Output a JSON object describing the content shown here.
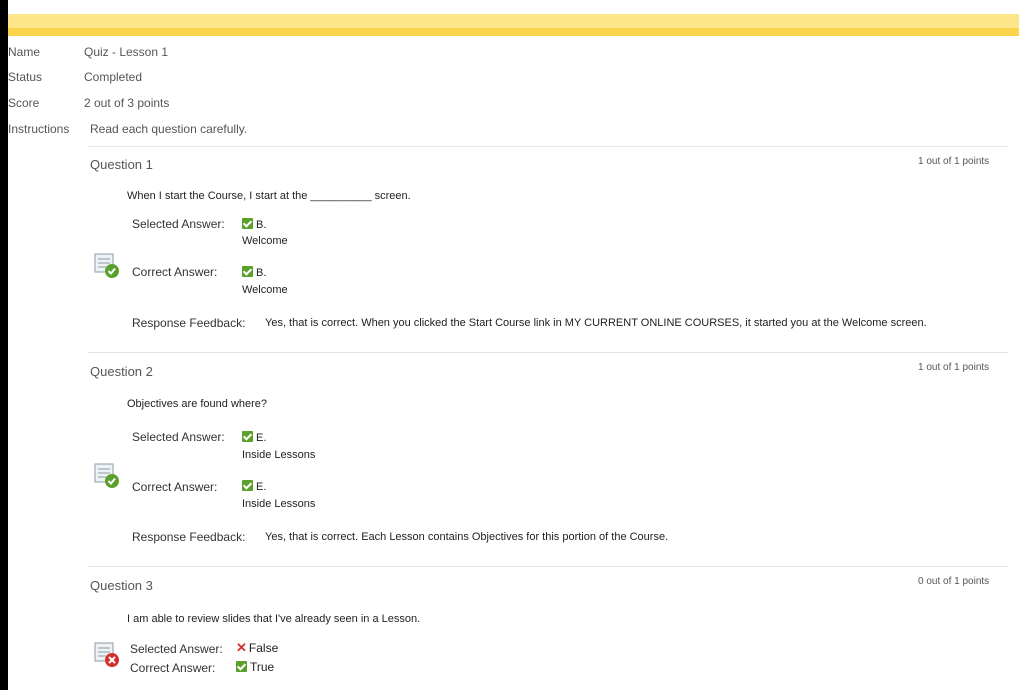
{
  "summary": {
    "name_label": "Name",
    "name_value": "Quiz - Lesson 1",
    "status_label": "Status",
    "status_value": "Completed",
    "score_label": "Score",
    "score_value": "2 out of 3 points",
    "instructions_label": "Instructions",
    "instructions_value": "Read each question carefully."
  },
  "questions": [
    {
      "title": "Question 1",
      "points": "1 out of 1 points",
      "text": "When I start the Course, I start at the __________ screen.",
      "selected_label": "Selected Answer:",
      "selected_letter": "B.",
      "selected_value": "Welcome",
      "correct_label": "Correct Answer:",
      "correct_letter": "B.",
      "correct_value": "Welcome",
      "feedback_label": "Response Feedback:",
      "feedback_text": "Yes, that is correct.  When you clicked the Start Course link in MY CURRENT ONLINE COURSES, it started you at the Welcome screen.",
      "result": "correct"
    },
    {
      "title": "Question 2",
      "points": "1 out of 1 points",
      "text": "Objectives are found where?",
      "selected_label": "Selected Answer:",
      "selected_letter": "E.",
      "selected_value": "Inside Lessons",
      "correct_label": "Correct Answer:",
      "correct_letter": "E.",
      "correct_value": "Inside Lessons",
      "feedback_label": "Response Feedback:",
      "feedback_text": "Yes, that is correct.  Each Lesson contains Objectives for this portion of the Course.",
      "result": "correct"
    },
    {
      "title": "Question 3",
      "points": "0 out of 1 points",
      "text": "I am able to review slides that I've already seen in a Lesson.",
      "selected_label": "Selected Answer:",
      "selected_value": "False",
      "correct_label": "Correct Answer:",
      "correct_value": "True",
      "result": "incorrect"
    }
  ],
  "colors": {
    "header_yellow": "#fde68a",
    "header_yellow_dark": "#fcd34d",
    "check_green": "#5aa02c",
    "wrong_red": "#d32f2f"
  }
}
